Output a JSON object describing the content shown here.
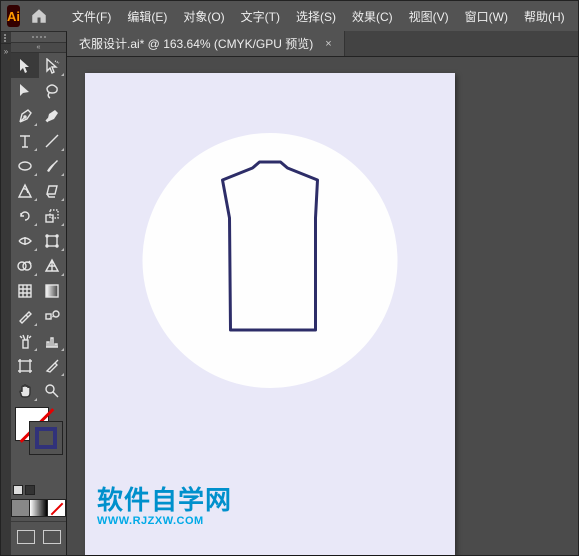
{
  "app_icon_text": "Ai",
  "menu": {
    "file": "文件(F)",
    "edit": "编辑(E)",
    "object": "对象(O)",
    "type": "文字(T)",
    "select": "选择(S)",
    "effect": "效果(C)",
    "view": "视图(V)",
    "window": "窗口(W)",
    "help": "帮助(H)"
  },
  "tab": {
    "title": "衣服设计.ai* @ 163.64% (CMYK/GPU 预览)",
    "close": "×"
  },
  "watermark": {
    "cn": "软件自学网",
    "en": "WWW.RJZXW.COM"
  },
  "toolnames": {
    "selection": "selection-tool",
    "direct": "direct-selection-tool",
    "magic": "magic-wand-tool",
    "lasso": "lasso-tool",
    "pen": "pen-tool",
    "curvature": "curvature-tool",
    "type": "type-tool",
    "line": "line-segment-tool",
    "ellipse": "ellipse-tool",
    "brush": "paintbrush-tool",
    "shaper": "shaper-tool",
    "eraser": "eraser-tool",
    "rotate": "rotate-tool",
    "scale": "scale-tool",
    "width": "width-tool",
    "free": "free-transform-tool",
    "shapebuilder": "shape-builder-tool",
    "perspective": "perspective-grid-tool",
    "mesh": "mesh-tool",
    "gradient": "gradient-tool",
    "eyedropper": "eyedropper-tool",
    "blend": "blend-tool",
    "symbol": "symbol-sprayer-tool",
    "graph": "column-graph-tool",
    "artboard": "artboard-tool",
    "slice": "slice-tool",
    "hand": "hand-tool",
    "zoom": "zoom-tool"
  }
}
